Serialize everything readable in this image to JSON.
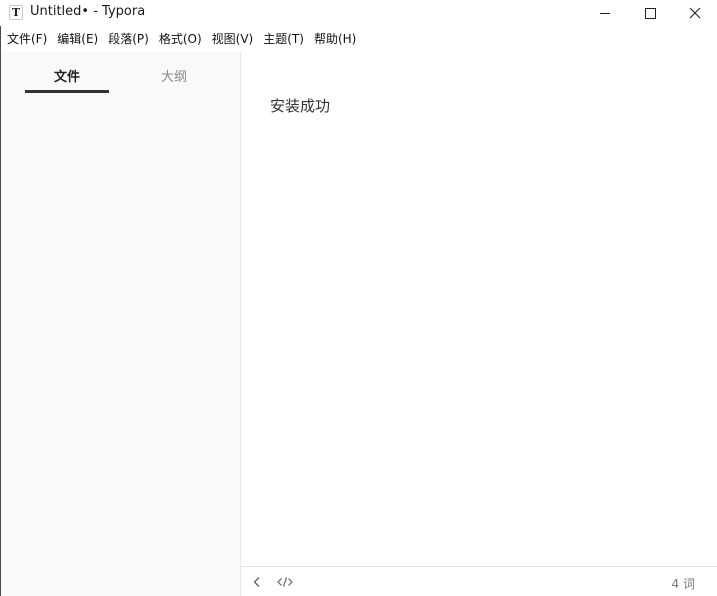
{
  "window": {
    "title": "Untitled• - Typora",
    "icon_letter": "T"
  },
  "menubar": {
    "items": [
      {
        "label": "文件(F)"
      },
      {
        "label": "编辑(E)"
      },
      {
        "label": "段落(P)"
      },
      {
        "label": "格式(O)"
      },
      {
        "label": "视图(V)"
      },
      {
        "label": "主题(T)"
      },
      {
        "label": "帮助(H)"
      }
    ]
  },
  "sidebar": {
    "tabs": [
      {
        "label": "文件",
        "active": true
      },
      {
        "label": "大纲",
        "active": false
      }
    ]
  },
  "editor": {
    "content": "安装成功"
  },
  "footer": {
    "word_count": "4 词"
  },
  "colors": {
    "sidebar_bg": "#f9f9f9",
    "active_tab_indicator": "#333333",
    "text": "#333333"
  },
  "icons": [
    "typora-app-icon",
    "minimize-icon",
    "maximize-icon",
    "close-icon",
    "chevron-left-icon",
    "code-icon"
  ]
}
